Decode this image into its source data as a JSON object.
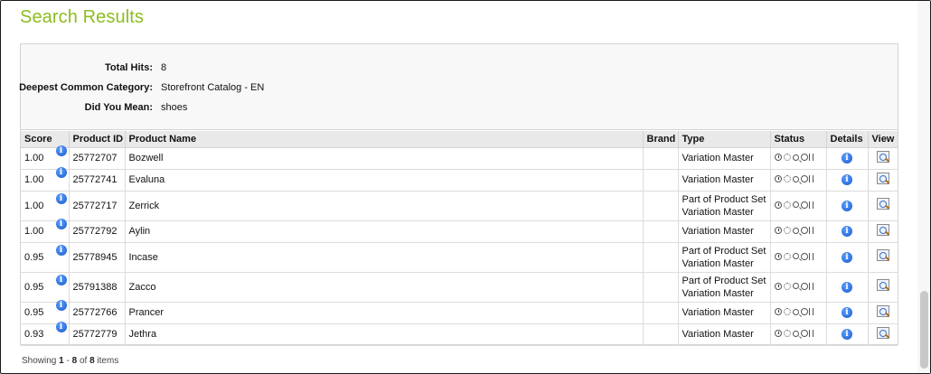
{
  "page": {
    "title": "Search Results"
  },
  "summary": {
    "total_hits_label": "Total Hits:",
    "total_hits_value": "8",
    "category_label": "Deepest Common Category:",
    "category_value": "Storefront Catalog - EN",
    "did_you_mean_label": "Did You Mean:",
    "did_you_mean_value": "shoes"
  },
  "table": {
    "columns": [
      "Score",
      "Product ID",
      "Product Name",
      "Brand",
      "Type",
      "Status",
      "Details",
      "View"
    ],
    "rows": [
      {
        "score": "1.00",
        "id": "25772707",
        "name": "Bozwell",
        "brand": "",
        "type1": "Variation Master",
        "type2": ""
      },
      {
        "score": "1.00",
        "id": "25772741",
        "name": "Evaluna",
        "brand": "",
        "type1": "Variation Master",
        "type2": ""
      },
      {
        "score": "1.00",
        "id": "25772717",
        "name": "Zerrick",
        "brand": "",
        "type1": "Part of Product Set",
        "type2": "Variation Master"
      },
      {
        "score": "1.00",
        "id": "25772792",
        "name": "Aylin",
        "brand": "",
        "type1": "Variation Master",
        "type2": ""
      },
      {
        "score": "0.95",
        "id": "25778945",
        "name": "Incase",
        "brand": "",
        "type1": "Part of Product Set",
        "type2": "Variation Master"
      },
      {
        "score": "0.95",
        "id": "25791388",
        "name": "Zacco",
        "brand": "",
        "type1": "Part of Product Set",
        "type2": "Variation Master"
      },
      {
        "score": "0.95",
        "id": "25772766",
        "name": "Prancer",
        "brand": "",
        "type1": "Variation Master",
        "type2": ""
      },
      {
        "score": "0.93",
        "id": "25772779",
        "name": "Jethra",
        "brand": "",
        "type1": "Variation Master",
        "type2": ""
      }
    ]
  },
  "footer": {
    "prefix": "Showing",
    "start": "1",
    "sep": "-",
    "end": "8",
    "of": "of",
    "total": "8",
    "suffix": "items"
  },
  "icons": {
    "info": "info-icon",
    "status": [
      "clock-icon",
      "gear-icon",
      "magnifier-icon",
      "key-icon"
    ],
    "view": "preview-magnifier-icon"
  },
  "colors": {
    "title": "#8bbd1e",
    "header_bg": "#e9e9e9",
    "summary_bg": "#f8f8f8",
    "info_blue": "#1a56c8"
  }
}
